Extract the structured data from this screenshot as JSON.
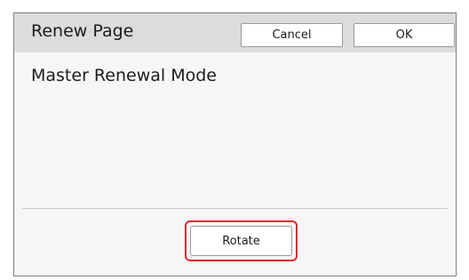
{
  "dialog": {
    "title": "Renew Page",
    "cancel_label": "Cancel",
    "ok_label": "OK",
    "mode_label": "Master Renewal Mode",
    "rotate_label": "Rotate"
  },
  "colors": {
    "highlight": "#e0262b",
    "title_bar": "#dcdcdc",
    "panel": "#f6f6f6"
  }
}
